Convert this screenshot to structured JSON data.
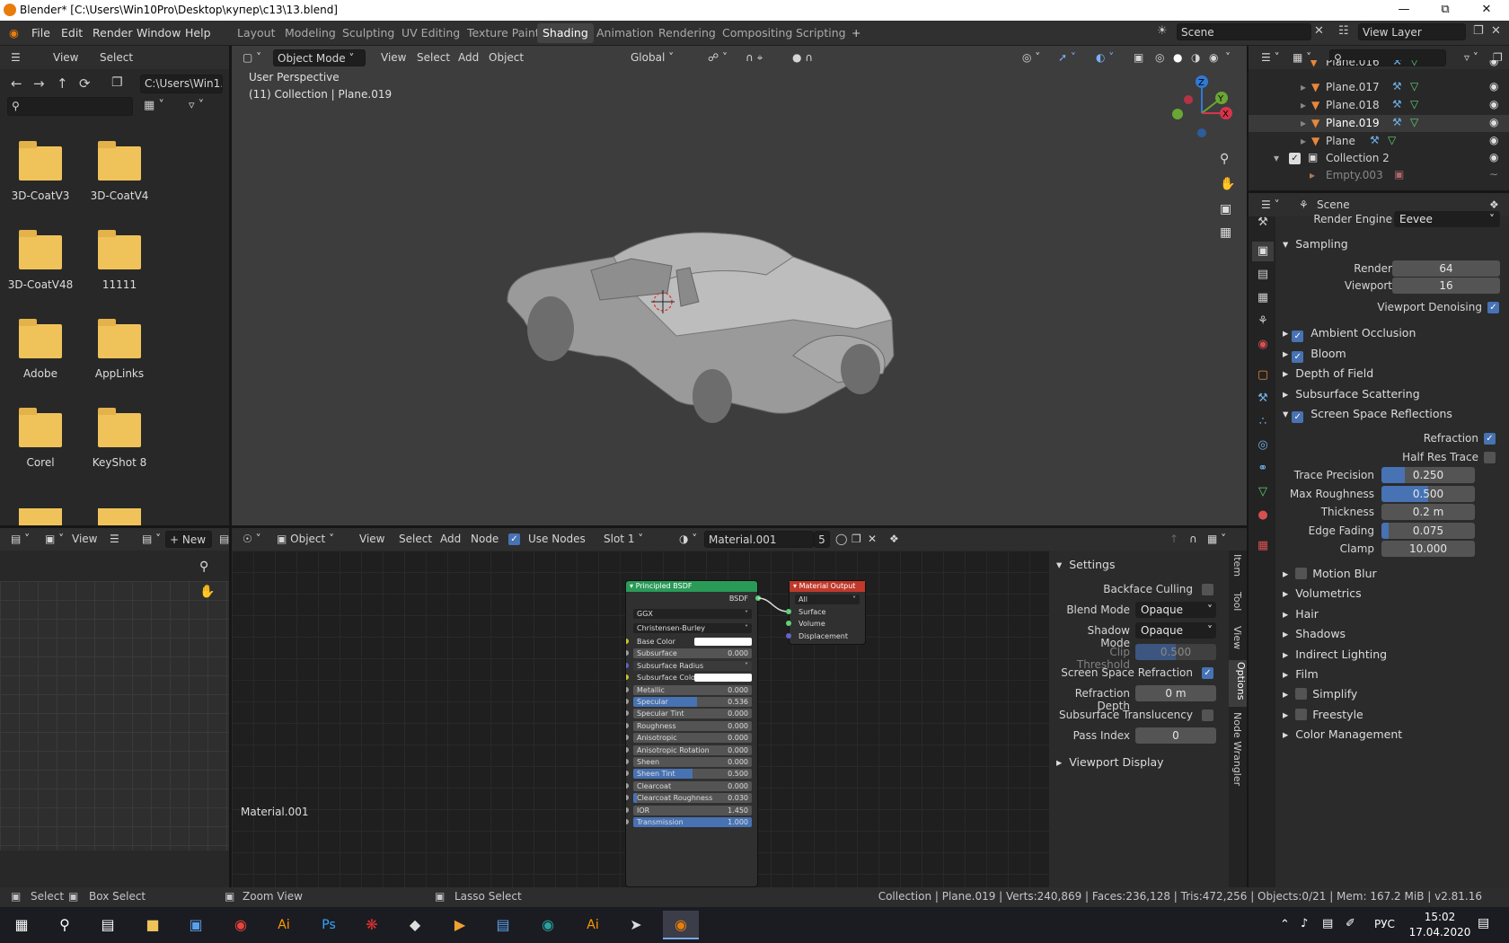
{
  "window": {
    "title": "Blender* [C:\\Users\\Win10Pro\\Desktop\\купер\\c13\\13.blend]"
  },
  "menu": [
    "File",
    "Edit",
    "Render",
    "Window",
    "Help"
  ],
  "workspaces": [
    "Layout",
    "Modeling",
    "Sculpting",
    "UV Editing",
    "Texture Paint",
    "Shading",
    "Animation",
    "Rendering",
    "Compositing",
    "Scripting"
  ],
  "active_workspace": "Shading",
  "scene": "Scene",
  "view_layer": "View Layer",
  "filebrowser": {
    "view": "View",
    "select": "Select",
    "path": "C:\\Users\\Win1...",
    "folders": [
      "3D-CoatV3",
      "3D-CoatV4",
      "3D-CoatV48",
      "11111",
      "Adobe",
      "AppLinks",
      "Corel",
      "KeyShot 8"
    ]
  },
  "viewport": {
    "mode": "Object Mode",
    "menus": [
      "View",
      "Select",
      "Add",
      "Object"
    ],
    "orientation": "Global",
    "perspective": "User Perspective",
    "collection": "(11) Collection | Plane.019",
    "axes": {
      "x": "X",
      "y": "Y",
      "z": "Z"
    }
  },
  "node_editor": {
    "type": "Object",
    "menus": [
      "View",
      "Select",
      "Add",
      "Node"
    ],
    "use_nodes": "Use Nodes",
    "slot": "Slot 1",
    "material": "Material.001",
    "users": "5",
    "material_label": "Material.001"
  },
  "image_editor": {
    "view": "View",
    "new": "New"
  },
  "outliner": {
    "rows": [
      "Plane.016",
      "Plane.017",
      "Plane.018",
      "Plane.019",
      "Plane",
      "Collection 2",
      "Empty.003"
    ]
  },
  "properties": {
    "context": "Scene",
    "render_engine_label": "Render Engine",
    "render_engine": "Eevee",
    "sampling": "Sampling",
    "render_label": "Render",
    "render": "64",
    "viewport_label": "Viewport",
    "viewport": "16",
    "denoise": "Viewport Denoising",
    "sections_checked": [
      "Ambient Occlusion",
      "Bloom"
    ],
    "sections_plain": [
      "Depth of Field",
      "Subsurface Scattering"
    ],
    "ssr": "Screen Space Reflections",
    "refraction": "Refraction",
    "half_res": "Half Res Trace",
    "ssr_fields": [
      {
        "label": "Trace Precision",
        "value": "0.250",
        "fill": 0.25
      },
      {
        "label": "Max Roughness",
        "value": "0.500",
        "fill": 0.5
      },
      {
        "label": "Thickness",
        "value": "0.2 m",
        "fill": 0
      },
      {
        "label": "Edge Fading",
        "value": "0.075",
        "fill": 0.075
      },
      {
        "label": "Clamp",
        "value": "10.000",
        "fill": 0
      }
    ],
    "after_sections": [
      {
        "label": "Motion Blur",
        "check": true
      },
      {
        "label": "Volumetrics",
        "check": false
      },
      {
        "label": "Hair",
        "check": false
      },
      {
        "label": "Shadows",
        "check": false
      },
      {
        "label": "Indirect Lighting",
        "check": false
      },
      {
        "label": "Film",
        "check": false
      },
      {
        "label": "Simplify",
        "check": true
      },
      {
        "label": "Freestyle",
        "check": true
      },
      {
        "label": "Color Management",
        "check": false
      }
    ]
  },
  "sidebar": {
    "settings": "Settings",
    "backface": "Backface Culling",
    "blend_label": "Blend Mode",
    "blend": "Opaque",
    "shadow_label": "Shadow Mode",
    "shadow": "Opaque",
    "clip_label": "Clip Threshold",
    "clip": "0.500",
    "ssr": "Screen Space Refraction",
    "depth_label": "Refraction Depth",
    "depth": "0 m",
    "translucency": "Subsurface Translucency",
    "pass_label": "Pass Index",
    "pass": "0",
    "viewport_display": "Viewport Display",
    "tabs": [
      "Item",
      "Tool",
      "View",
      "Options",
      "Node Wrangler"
    ]
  },
  "bsdf": {
    "title": "Principled BSDF",
    "out": "BSDF",
    "dist": "GGX",
    "sss": "Christensen-Burley",
    "rows": [
      {
        "label": "Base Color",
        "value": "",
        "kind": "color"
      },
      {
        "label": "Subsurface",
        "value": "0.000",
        "fill": 0
      },
      {
        "label": "Subsurface Radius",
        "value": "",
        "kind": "vec"
      },
      {
        "label": "Subsurface Color",
        "value": "",
        "kind": "color"
      },
      {
        "label": "Metallic",
        "value": "0.000",
        "fill": 0
      },
      {
        "label": "Specular",
        "value": "0.536",
        "fill": 0.536
      },
      {
        "label": "Specular Tint",
        "value": "0.000",
        "fill": 0
      },
      {
        "label": "Roughness",
        "value": "0.000",
        "fill": 0
      },
      {
        "label": "Anisotropic",
        "value": "0.000",
        "fill": 0
      },
      {
        "label": "Anisotropic Rotation",
        "value": "0.000",
        "fill": 0
      },
      {
        "label": "Sheen",
        "value": "0.000",
        "fill": 0
      },
      {
        "label": "Sheen Tint",
        "value": "0.500",
        "fill": 0.5
      },
      {
        "label": "Clearcoat",
        "value": "0.000",
        "fill": 0
      },
      {
        "label": "Clearcoat Roughness",
        "value": "0.030",
        "fill": 0.03
      },
      {
        "label": "IOR",
        "value": "1.450",
        "fill": 0
      },
      {
        "label": "Transmission",
        "value": "1.000",
        "fill": 1
      }
    ]
  },
  "matout": {
    "title": "Material Output",
    "target": "All",
    "inputs": [
      "Surface",
      "Volume",
      "Displacement"
    ]
  },
  "status": {
    "select": "Select",
    "box": "Box Select",
    "zoom": "Zoom View",
    "lasso": "Lasso Select",
    "info": "Collection | Plane.019 | Verts:240,869 | Faces:236,128 | Tris:472,256 | Objects:0/21 | Mem: 167.2 MiB | v2.81.16"
  },
  "taskbar": {
    "lang": "РУС",
    "time": "15:02",
    "date": "17.04.2020"
  },
  "colors": {
    "accent": "#4772b3",
    "active_tab": "#444444",
    "bsdf_header": "#2a9a58",
    "output_header": "#c0392b"
  }
}
